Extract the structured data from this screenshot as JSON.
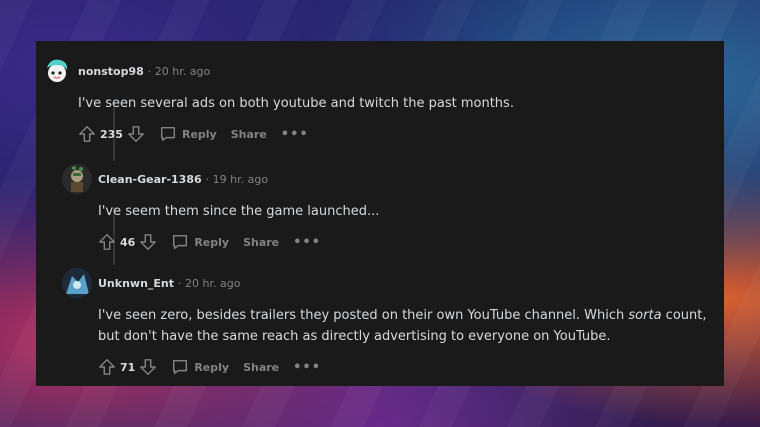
{
  "comments": [
    {
      "username": "nonstop98",
      "time": "· 20 hr. ago",
      "text": "I've seen several ads on both youtube and twitch the past months.",
      "votes": "235",
      "reply_label": "Reply",
      "share_label": "Share",
      "more_label": "•••"
    },
    {
      "username": "Clean-Gear-1386",
      "time": "· 19 hr. ago",
      "text": "I've seem them since the game launched...",
      "votes": "46",
      "reply_label": "Reply",
      "share_label": "Share",
      "more_label": "•••"
    },
    {
      "username": "Unknwn_Ent",
      "time": "· 20 hr. ago",
      "text_before": "I've seen zero, besides trailers they posted on their own YouTube channel. Which ",
      "text_em": "sorta",
      "text_after": " count, but don't have the same reach as directly advertising to everyone on YouTube.",
      "votes": "71",
      "reply_label": "Reply",
      "share_label": "Share",
      "more_label": "•••"
    }
  ],
  "colors": {
    "card_bg": "#1a1a1b",
    "text": "#d7dadc",
    "muted": "#818384"
  }
}
